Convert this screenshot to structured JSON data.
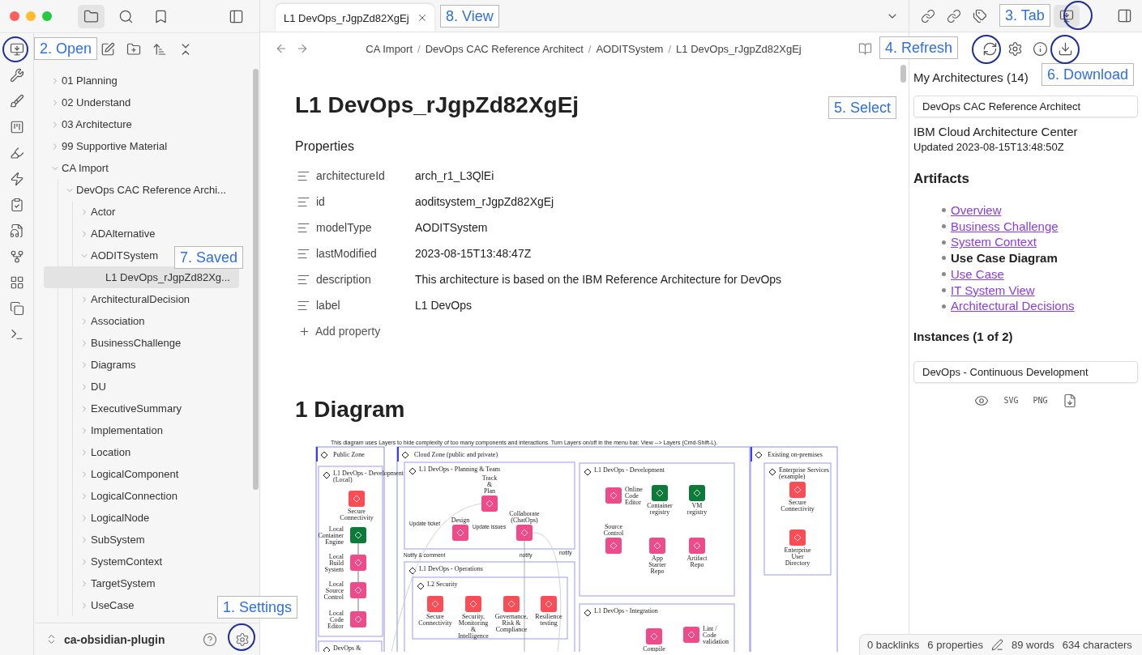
{
  "sidebar_tabs": [
    {
      "kind": "files",
      "selected": true
    },
    {
      "kind": "search",
      "selected": false
    },
    {
      "kind": "bookmarks",
      "selected": false
    }
  ],
  "file_tree": [
    {
      "label": "01 Planning",
      "expanded": false
    },
    {
      "label": "02 Understand",
      "expanded": false
    },
    {
      "label": "03 Architecture",
      "expanded": false
    },
    {
      "label": "99 Supportive Material",
      "expanded": false
    },
    {
      "label": "CA Import",
      "expanded": true,
      "children": [
        {
          "label": "DevOps CAC Reference Archi...",
          "expanded": true,
          "children": [
            {
              "label": "Actor",
              "expanded": false
            },
            {
              "label": "ADAlternative",
              "expanded": false
            },
            {
              "label": "AODITSystem",
              "expanded": true,
              "children": [
                {
                  "label": "L1 DevOps_rJgpZd82Xg...",
                  "selected": true
                }
              ]
            },
            {
              "label": "ArchitecturalDecision",
              "expanded": false
            },
            {
              "label": "Association",
              "expanded": false
            },
            {
              "label": "BusinessChallenge",
              "expanded": false
            },
            {
              "label": "Diagrams",
              "expanded": false
            },
            {
              "label": "DU",
              "expanded": false
            },
            {
              "label": "ExecutiveSummary",
              "expanded": false
            },
            {
              "label": "Implementation",
              "expanded": false
            },
            {
              "label": "Location",
              "expanded": false
            },
            {
              "label": "LogicalComponent",
              "expanded": false
            },
            {
              "label": "LogicalConnection",
              "expanded": false
            },
            {
              "label": "LogicalNode",
              "expanded": false
            },
            {
              "label": "SubSystem",
              "expanded": false
            },
            {
              "label": "SystemContext",
              "expanded": false
            },
            {
              "label": "TargetSystem",
              "expanded": false
            },
            {
              "label": "UseCase",
              "expanded": false
            }
          ]
        }
      ]
    }
  ],
  "vault": {
    "name": "ca-obsidian-plugin"
  },
  "tabs": [
    {
      "title": "L1 DevOps_rJgpZd82XgEj",
      "selected": true
    }
  ],
  "breadcrumb": [
    "CA Import",
    "DevOps CAC Reference Architect",
    "AODITSystem",
    "L1 DevOps_rJgpZd82XgEj"
  ],
  "breadcrumb_separator": "/",
  "note": {
    "title": "L1 DevOps_rJgpZd82XgEj",
    "properties_heading": "Properties",
    "properties": [
      {
        "key": "architectureId",
        "value": "arch_r1_L3QlEi"
      },
      {
        "key": "id",
        "value": "aoditsystem_rJgpZd82XgEj"
      },
      {
        "key": "modelType",
        "value": "AODITSystem"
      },
      {
        "key": "lastModified",
        "value": "2023-08-15T13:48:47Z"
      },
      {
        "key": "description",
        "value": "This architecture is based on the IBM Reference Architecture for DevOps"
      },
      {
        "key": "label",
        "value": "L1 DevOps"
      }
    ],
    "add_property": "Add property",
    "section_heading": "1 Diagram",
    "diagram": {
      "caption": "This diagram uses Layers to hide complexity of too many components and interactions. Turn Layers on/off in the menu bar: View --> Layers (Cmd-Shift-L).",
      "zones": [
        {
          "title": "Public Zone"
        },
        {
          "title": "Cloud Zone (public and private)"
        },
        {
          "title": "Existing on-premises"
        }
      ],
      "groups": [
        {
          "title": "L1 DevOps - Development\n(Local)"
        },
        {
          "title": "DevOps &"
        },
        {
          "title": "L1 DevOps - Planning & Team"
        },
        {
          "title": "L1 DevOps - Operations"
        },
        {
          "title": "L2 Security"
        },
        {
          "title": "L1 DevOps - Development"
        },
        {
          "title": "L1 DevOps - Integration"
        },
        {
          "title": "Enterprise Services\n(example)"
        }
      ],
      "nodes": [
        {
          "label": "Secure\nConnectivity",
          "color": "#fa4d56"
        },
        {
          "label": "Local\nContainer\nEngine",
          "color": "#0e7a3a"
        },
        {
          "label": "Local\nBuild\nSystem",
          "color": "#ee4b8b"
        },
        {
          "label": "Local\nSource\nControl",
          "color": "#ee4b8b"
        },
        {
          "label": "Local\nCode\nEditor",
          "color": "#ee4b8b"
        },
        {
          "label": "Track\n&\nPlan",
          "color": "#ee4b8b"
        },
        {
          "label": "Design",
          "color": "#ee4b8b"
        },
        {
          "label": "Collaborate\n(ChatOps)",
          "color": "#ee4b8b"
        },
        {
          "label": "Secure\nConnectivity",
          "color": "#fa4d56"
        },
        {
          "label": "Security,\nMonitoring\n&\nIntelligence",
          "color": "#fa4d56"
        },
        {
          "label": "Governance,\nRisk &\nCompliance",
          "color": "#fa4d56"
        },
        {
          "label": "Resilience\ntesting",
          "color": "#fa4d56"
        },
        {
          "label": "Online\nCode\nEditor",
          "color": "#ee4b8b"
        },
        {
          "label": "Container\nregistry",
          "color": "#0e7a3a"
        },
        {
          "label": "VM\nregistry",
          "color": "#0e7a3a"
        },
        {
          "label": "Source\nControl",
          "color": "#ee4b8b"
        },
        {
          "label": "App\nStarter\nRepo",
          "color": "#ee4b8b"
        },
        {
          "label": "Artifact\nRepo",
          "color": "#ee4b8b"
        },
        {
          "label": "Compile",
          "color": "#ee4b8b"
        },
        {
          "label": "Lint /\nCode\nvalidation",
          "color": "#ee4b8b"
        },
        {
          "label": "Secure\nConnectivity",
          "color": "#fa4d56"
        },
        {
          "label": "Enterprise\nUser\nDirectory",
          "color": "#fa4d56"
        }
      ],
      "edge_labels": [
        "Update ticket",
        "Update issues",
        "Notify & comment",
        "notify",
        "notify"
      ]
    }
  },
  "right_panel": {
    "heading": "My Architectures (14)",
    "selected_architecture": "DevOps CAC Reference Architect",
    "source": "IBM Cloud Architecture Center",
    "updated": "Updated 2023-08-15T13:48:50Z",
    "artifacts_heading": "Artifacts",
    "artifacts": [
      {
        "label": "Overview",
        "selected": false
      },
      {
        "label": "Business Challenge",
        "selected": false
      },
      {
        "label": "System Context",
        "selected": false
      },
      {
        "label": "Use Case Diagram",
        "selected": true
      },
      {
        "label": "Use Case",
        "selected": false
      },
      {
        "label": "IT System View",
        "selected": false
      },
      {
        "label": "Architectural Decisions",
        "selected": false
      }
    ],
    "instances_heading": "Instances (1 of 2)",
    "selected_instance": "DevOps - Continuous Development",
    "export_buttons": [
      "SVG",
      "PNG"
    ]
  },
  "status_bar": {
    "backlinks": "0 backlinks",
    "properties": "6 properties",
    "words": "89 words",
    "characters": "634 characters"
  },
  "annotations": [
    {
      "text": "1. Settings"
    },
    {
      "text": "2. Open"
    },
    {
      "text": "3. Tab"
    },
    {
      "text": "4. Refresh"
    },
    {
      "text": "5. Select"
    },
    {
      "text": "6. Download"
    },
    {
      "text": "7. Saved"
    },
    {
      "text": "8. View"
    }
  ]
}
